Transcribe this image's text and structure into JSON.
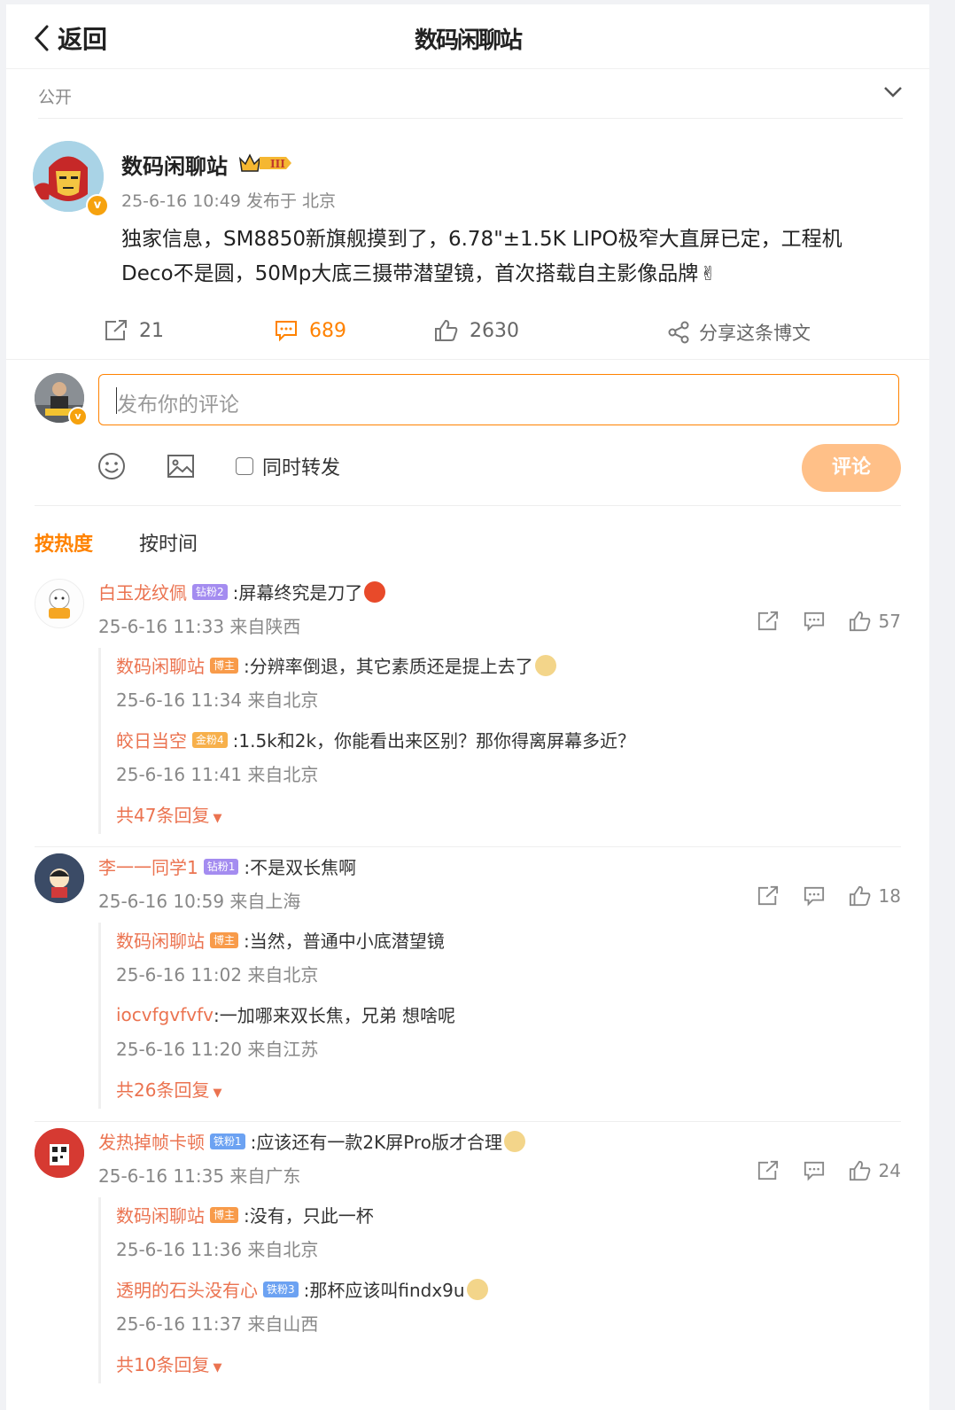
{
  "header": {
    "back_label": "返回",
    "title": "数码闲聊站"
  },
  "visibility": {
    "label": "公开"
  },
  "post": {
    "author": "数码闲聊站",
    "time": "25-6-16 10:49",
    "location": "发布于 北京",
    "text_line1": "独家信息，SM8850新旗舰摸到了，6.78\"±1.5K LIPO极窄大直屏已定，工程机",
    "text_line2": "Deco不是圆，50Mp大底三摄带潜望镜，首次搭载自主影像品牌",
    "reposts": "21",
    "comments": "689",
    "likes": "2630",
    "share_label": "分享这条博文"
  },
  "composer": {
    "placeholder": "发布你的评论",
    "repost_label": "同时转发",
    "submit_label": "评论"
  },
  "sort": {
    "hot": "按热度",
    "time": "按时间"
  },
  "comments": [
    {
      "name": "白玉龙纹佩",
      "badge": "钻粉2",
      "text": ":屏幕终究是刀了",
      "time": "25-6-16 11:33 来自陕西",
      "likes": "57",
      "replies": [
        {
          "name": "数码闲聊站",
          "badge": "博主",
          "text": ":分辨率倒退，其它素质还是提上去了",
          "time": "25-6-16 11:34 来自北京"
        },
        {
          "name": "皎日当空",
          "badge": "金粉4",
          "text": ":1.5k和2k，你能看出来区别？那你得离屏幕多近？",
          "time": "25-6-16 11:41 来自北京"
        }
      ],
      "more": "共47条回复"
    },
    {
      "name": "李一一同学1",
      "badge": "钻粉1",
      "text": ":不是双长焦啊",
      "time": "25-6-16 10:59 来自上海",
      "likes": "18",
      "replies": [
        {
          "name": "数码闲聊站",
          "badge": "博主",
          "text": ":当然，普通中小底潜望镜",
          "time": "25-6-16 11:02 来自北京"
        },
        {
          "name": "iocvfgvfvfv",
          "badge": "",
          "text": ":一加哪来双长焦，兄弟 想啥呢",
          "time": "25-6-16 11:20 来自江苏"
        }
      ],
      "more": "共26条回复"
    },
    {
      "name": "发热掉帧卡顿",
      "badge": "铁粉1",
      "text": ":应该还有一款2K屏Pro版才合理",
      "time": "25-6-16 11:35 来自广东",
      "likes": "24",
      "replies": [
        {
          "name": "数码闲聊站",
          "badge": "博主",
          "text": ":没有，只此一杯",
          "time": "25-6-16 11:36 来自北京"
        },
        {
          "name": "透明的石头没有心",
          "badge": "铁粉3",
          "text": ":那杯应该叫findx9u",
          "time": "25-6-16 11:37 来自山西"
        }
      ],
      "more": "共10条回复"
    }
  ],
  "colors": {
    "accent": "#ff8200",
    "name": "#eb7350",
    "button": "#ffc088"
  },
  "icons": [
    "chevron-left-icon",
    "chevron-down-icon",
    "repost-icon",
    "comment-icon",
    "like-icon",
    "share-icon",
    "emoji-icon",
    "image-icon",
    "crown-icon",
    "verified-icon"
  ]
}
